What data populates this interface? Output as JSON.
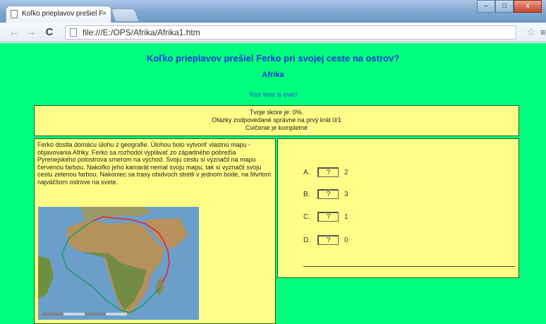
{
  "browser": {
    "tab_title": "Koľko prieplavov prešiel F",
    "tab_close": "×",
    "url": "file:///E:/OPS/Afrika/Afrika1.htm",
    "back_icon": "back-arrow-icon",
    "forward_icon": "forward-arrow-icon",
    "reload_icon": "reload-icon",
    "star_icon": "star-icon",
    "menu_icon": "menu-icon"
  },
  "page": {
    "title": "Koľko prieplavov prešiel Ferko pri svojej ceste na ostrov?",
    "subtitle": "Afrika",
    "timer": "Your time is over!",
    "score": {
      "line1": "Tvoje skóre je: 0%.",
      "line2": "Otázky zodpovedané správne na prvý krát 0/1",
      "line3": "Cvičenie je kompletné"
    },
    "question_text": "Ferko dostla domácu úlohu z geografie. Úlohou bolo vytvoriť vlastnú mapu - objavovania Afriky. Ferko sa rozhodol vyplávať zo západného pobrežia Pyrenejského polostrova smerom na východ. Svoju cestu si vyznačil na mapu červenou farbou. Nakoľko jeho kamarát nemal svoju mapu, tak si vyznačil svoju cestu zelenou farbou. Nakoniec sa trasy obidvoch stretli v jednom bode, na štvrtom najväčšom ostrove na svete.",
    "options": [
      {
        "letter": "A.",
        "button": "?",
        "value": "2"
      },
      {
        "letter": "B.",
        "button": "?",
        "value": "3"
      },
      {
        "letter": "C.",
        "button": "?",
        "value": "1"
      },
      {
        "letter": "D.",
        "button": "?",
        "value": "0"
      }
    ]
  },
  "colors": {
    "page_bg": "#00ff7f",
    "panel_bg": "#ffff88",
    "heading": "#1d33d9",
    "red_route": "#e8203a",
    "green_route": "#1f9a6b"
  }
}
